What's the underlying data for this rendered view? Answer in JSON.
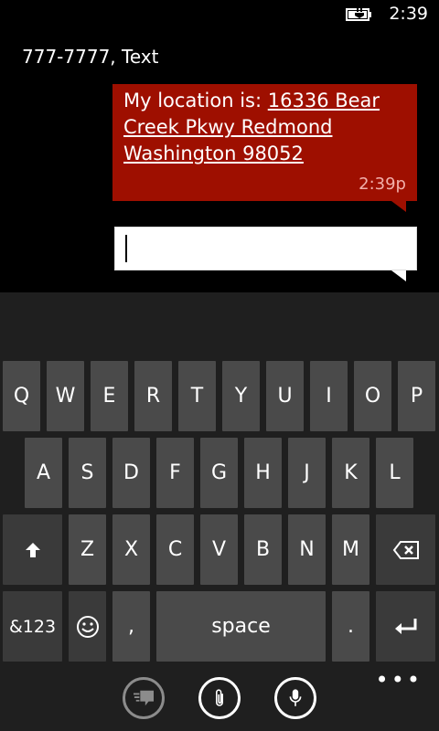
{
  "status": {
    "time": "2:39",
    "battery_icon": "battery-charging-icon"
  },
  "thread": {
    "title": "777-7777, Text"
  },
  "message": {
    "prefix": "My location is: ",
    "link_text": "16336 Bear Creek Pkwy Redmond Washington 98052",
    "timestamp": "2:39p",
    "bubble_color": "#9e0f00"
  },
  "compose": {
    "value": ""
  },
  "keyboard": {
    "row1": [
      "Q",
      "W",
      "E",
      "R",
      "T",
      "Y",
      "U",
      "I",
      "O",
      "P"
    ],
    "row2": [
      "A",
      "S",
      "D",
      "F",
      "G",
      "H",
      "J",
      "K",
      "L"
    ],
    "row3": [
      "Z",
      "X",
      "C",
      "V",
      "B",
      "N",
      "M"
    ],
    "symbols_label": "&123",
    "comma_label": ",",
    "space_label": "space",
    "period_label": ".",
    "shift_icon": "shift-arrow-icon",
    "backspace_icon": "backspace-icon",
    "enter_icon": "enter-icon",
    "emoji_icon": "emoji-icon"
  },
  "appbar": {
    "buttons": [
      {
        "icon": "switch-chat-icon"
      },
      {
        "icon": "attach-paperclip-icon"
      },
      {
        "icon": "microphone-icon"
      }
    ],
    "more_label": "•••"
  }
}
